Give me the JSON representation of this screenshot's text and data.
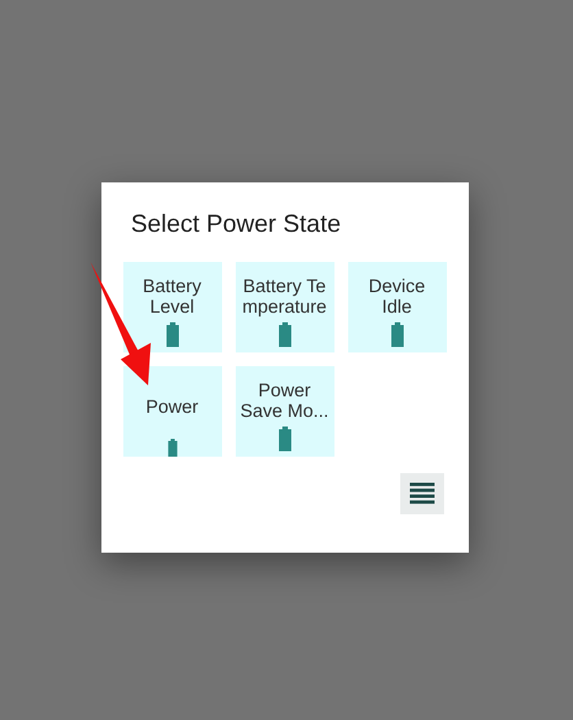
{
  "dialog": {
    "title": "Select Power State",
    "tiles": [
      {
        "lines": [
          "Battery",
          "Level"
        ]
      },
      {
        "lines": [
          "Battery Te",
          "mperature"
        ]
      },
      {
        "lines": [
          "Device",
          "Idle"
        ]
      },
      {
        "lines": [
          "Power"
        ]
      },
      {
        "lines": [
          "Power",
          "Save Mo..."
        ]
      }
    ]
  }
}
